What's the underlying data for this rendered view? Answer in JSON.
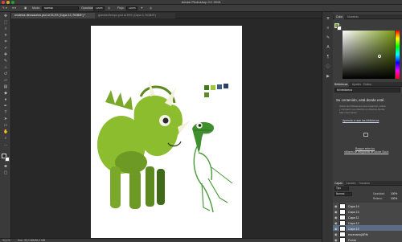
{
  "window": {
    "title": "Adobe Photoshop CC 2015"
  },
  "options_bar": {
    "mode_label": "Modo:",
    "mode_value": "Normal",
    "opacity_label": "Opacidad:",
    "opacity_value": "100%",
    "flow_label": "Flujo:",
    "flow_value": "100%"
  },
  "doc_tabs": [
    {
      "label": "modelos dinosaurios.psd al 33,3% (Capa 13, RGB/8*) *"
    },
    {
      "label": "grandes\\fempo.psd al 25% (Capa 3, RGB/8*)"
    }
  ],
  "status": {
    "zoom": "33,1%",
    "doc_size": "Doc: 30,0 MB/85,0 MB"
  },
  "color_panel": {
    "tabs": [
      "Color",
      "Muestras"
    ]
  },
  "libraries_panel": {
    "tabs": [
      "Bibliotecas",
      "Ajustes",
      "Estilos"
    ],
    "library_name": "Mi biblioteca",
    "headline": "Su contenido, está donde esté.",
    "body_lines": [
      "Utilice las bibliotecas para organizar, utilizar",
      "y compartir sus diseños en diseños Adobe.",
      "Más información"
    ],
    "link": "Aprenda a usar las bibliotecas",
    "stock_lines": [
      "Busque entre los",
      "millones de fotografías de Adobe Stock"
    ]
  },
  "layers_panel": {
    "tabs": [
      "Capas",
      "Canales",
      "Trazados"
    ],
    "kind": "Tipo",
    "blend": "Normal",
    "opacity_label": "Opacidad:",
    "opacity_value": "100%",
    "fill_label": "Relleno:",
    "fill_value": "100%",
    "layers": [
      {
        "name": "Capa 14",
        "selected": false
      },
      {
        "name": "Capa 13",
        "selected": false
      },
      {
        "name": "Capa 11",
        "selected": false
      },
      {
        "name": "Capa 12",
        "selected": false
      },
      {
        "name": "Capa 15",
        "selected": true
      },
      {
        "name": "escenario(ARM",
        "selected": false
      },
      {
        "name": "Fondo",
        "selected": false
      }
    ]
  },
  "colors": {
    "accent": "#7a9a16",
    "selection": "#5b6c86",
    "dino_green": "#8bbd2f",
    "raptor_green": "#3f8f2e"
  }
}
